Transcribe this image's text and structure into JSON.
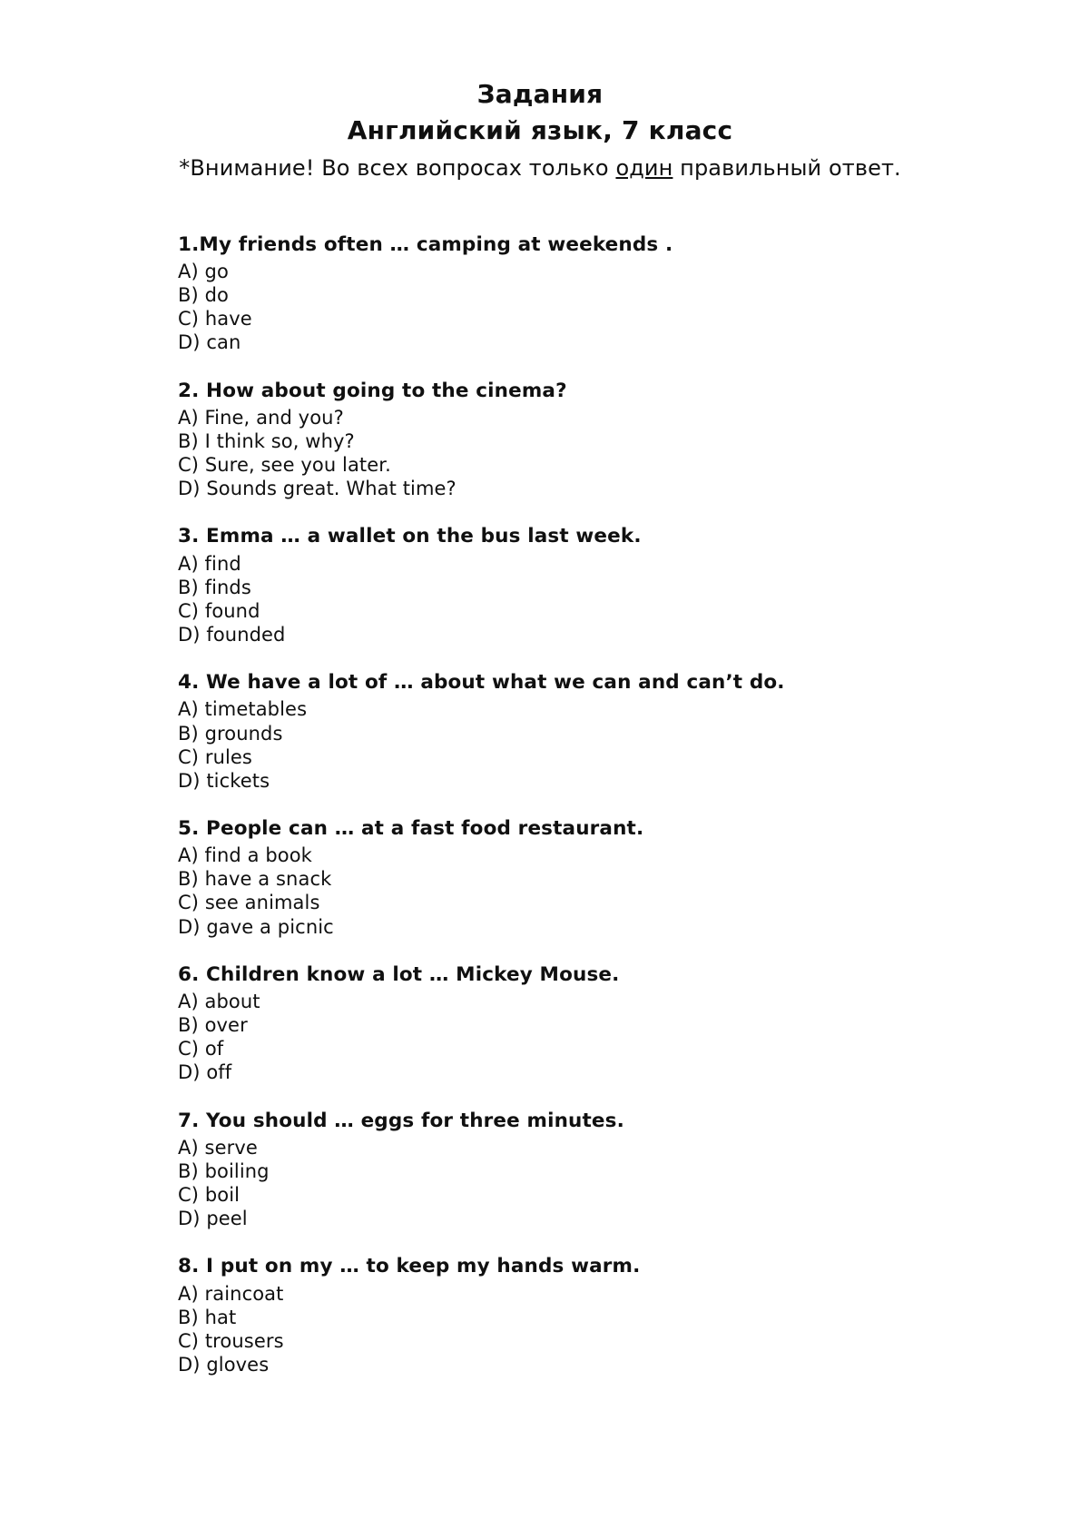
{
  "document": {
    "title_main": "Задания",
    "title_sub": "Английский язык, 7 класс",
    "notice_prefix": "*Внимание! Во всех вопросах только ",
    "notice_emphasis": "один",
    "notice_suffix": " правильный ответ.",
    "background_color": "#ffffff",
    "text_color": "#101010"
  },
  "questions": [
    {
      "number": "1.",
      "stem": "1.My friends often …  camping at weekends .",
      "options": [
        "A) go",
        "B) do",
        "C) have",
        "D) can"
      ]
    },
    {
      "number": "2.",
      "stem": "2. How about going to the cinema?",
      "options": [
        "A) Fine, and you?",
        "B) I think so, why?",
        "C) Sure, see you later.",
        "D) Sounds great. What time?"
      ]
    },
    {
      "number": "3.",
      "stem": "3. Emma …  a wallet on the bus last week.",
      "options": [
        "A) find",
        "B) finds",
        "C) found",
        "D) founded"
      ]
    },
    {
      "number": "4.",
      "stem": "4. We have a lot of …  about what we can and can’t do.",
      "options": [
        "A) timetables",
        "B) grounds",
        "C) rules",
        "D) tickets"
      ]
    },
    {
      "number": "5.",
      "stem": "5. People can …  at a fast food restaurant.",
      "options": [
        "A) find a book",
        "B) have a snack",
        "C) see animals",
        "D) gave a picnic"
      ]
    },
    {
      "number": "6.",
      "stem": "6. Children know a lot …  Mickey Mouse.",
      "options": [
        "A) about",
        "B) over",
        "C) of",
        "D) off"
      ]
    },
    {
      "number": "7.",
      "stem": "7. You should …  eggs for three minutes.",
      "options": [
        "A) serve",
        "B) boiling",
        "C) boil",
        "D) peel"
      ]
    },
    {
      "number": "8.",
      "stem": "8. I put on my …  to keep my hands warm.",
      "options": [
        "A) raincoat",
        "B) hat",
        "C) trousers",
        "D) gloves"
      ]
    }
  ]
}
